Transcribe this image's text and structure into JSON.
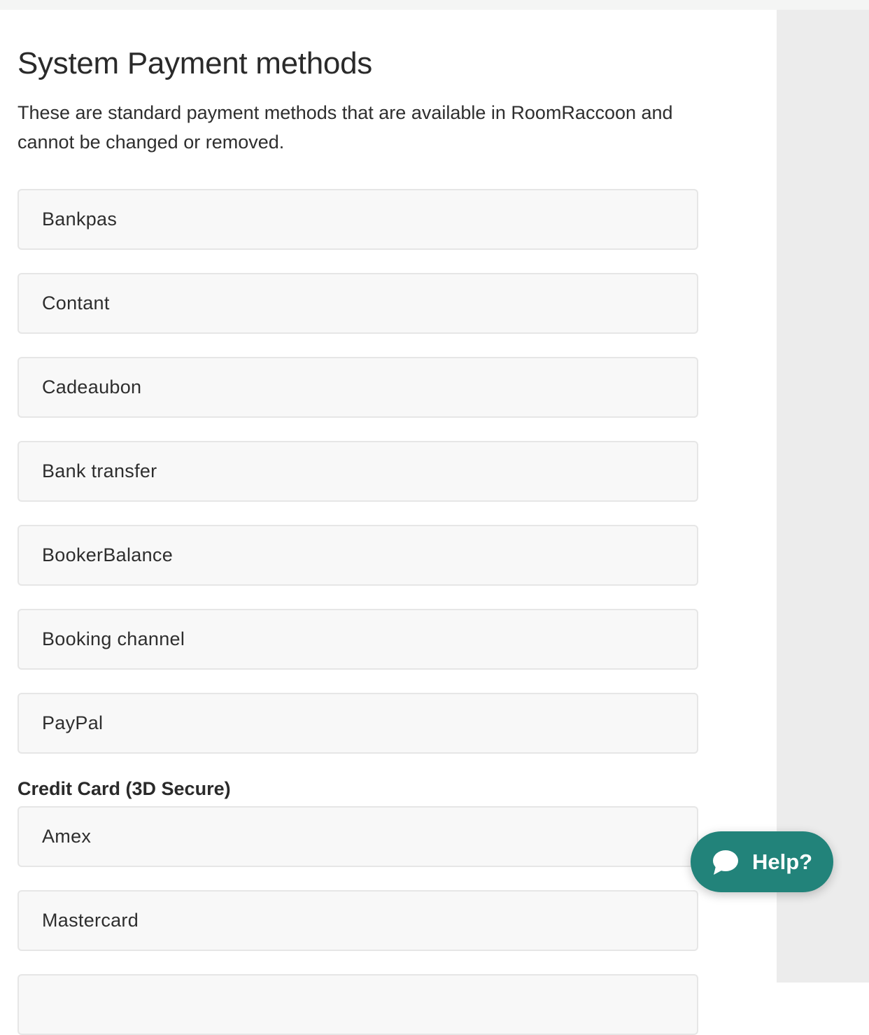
{
  "page": {
    "title": "System Payment methods",
    "description": "These are standard payment methods that are available in RoomRaccoon and cannot be changed or removed."
  },
  "system_methods": [
    {
      "label": "Bankpas"
    },
    {
      "label": "Contant"
    },
    {
      "label": "Cadeaubon"
    },
    {
      "label": "Bank transfer"
    },
    {
      "label": "BookerBalance"
    },
    {
      "label": "Booking channel"
    },
    {
      "label": "PayPal"
    }
  ],
  "credit_card_section": {
    "heading": "Credit Card (3D Secure)",
    "methods": [
      {
        "label": "Amex"
      },
      {
        "label": "Mastercard"
      },
      {
        "label": ""
      }
    ]
  },
  "help_button": {
    "label": "Help?",
    "icon": "chat-bubble-icon",
    "color": "#22837a"
  },
  "colors": {
    "row_background": "#f8f8f8",
    "row_border": "#e6e6e6",
    "side_panel": "#ececec"
  }
}
